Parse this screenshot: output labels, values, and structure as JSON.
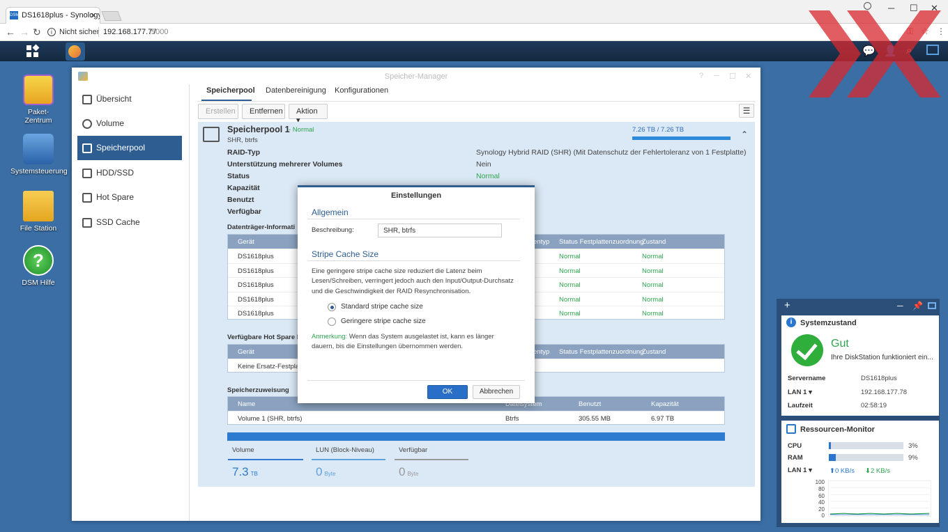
{
  "browser": {
    "tab_title": "DS1618plus - Synology D",
    "tab_close": "×",
    "fav_label": "DSM",
    "win_min": "─",
    "win_max": "☐",
    "win_close": "✕",
    "security_label": "Nicht sicher",
    "url_host": "192.168.177.77",
    "url_port": ":5000"
  },
  "desktop": {
    "icons": [
      {
        "label": "Paket-\nZentrum"
      },
      {
        "label": "Systemsteuerung"
      },
      {
        "label": "File Station"
      },
      {
        "label": "DSM Hilfe"
      }
    ]
  },
  "window": {
    "title": "Speicher-Manager",
    "controls": [
      "?",
      "─",
      "☐",
      "✕"
    ]
  },
  "sidebar": {
    "items": [
      {
        "label": "Übersicht"
      },
      {
        "label": "Volume"
      },
      {
        "label": "Speicherpool"
      },
      {
        "label": "HDD/SSD"
      },
      {
        "label": "Hot Spare"
      },
      {
        "label": "SSD Cache"
      }
    ]
  },
  "tabs": [
    {
      "label": "Speicherpool"
    },
    {
      "label": "Datenbereinigung"
    },
    {
      "label": "Konfigurationen"
    }
  ],
  "toolbar": {
    "create": "Erstellen",
    "remove": "Entfernen",
    "action": "Aktion ▾"
  },
  "pool": {
    "name": "Speicherpool 1",
    "status": "- Normal",
    "subtitle": "SHR, btrfs",
    "capacity_text": "7.26 TB / 7.26 TB",
    "capacity_fraction": 1.0,
    "props": [
      {
        "label": "RAID-Typ",
        "value": "Synology Hybrid RAID (SHR) (Mit Datenschutz der Fehlertoleranz von 1 Festplatte)"
      },
      {
        "label": "Unterstützung mehrerer Volumes",
        "value": "Nein"
      },
      {
        "label": "Status",
        "value": "Normal"
      },
      {
        "label": "Kapazität",
        "value": ""
      },
      {
        "label": "Benutzt",
        "value": ""
      },
      {
        "label": "Verfügbar",
        "value": ""
      }
    ],
    "disk_section": "Datenträger-Informati",
    "disk_headers": [
      "Gerät",
      "entyp",
      "Status Festplattenzuordnung",
      "Zustand"
    ],
    "disks": [
      {
        "device": "DS1618plus",
        "status": "Normal",
        "health": "Normal"
      },
      {
        "device": "DS1618plus",
        "status": "Normal",
        "health": "Normal"
      },
      {
        "device": "DS1618plus",
        "status": "Normal",
        "health": "Normal"
      },
      {
        "device": "DS1618plus",
        "status": "Normal",
        "health": "Normal"
      },
      {
        "device": "DS1618plus",
        "status": "Normal",
        "health": "Normal"
      }
    ],
    "hotspare_section": "Verfügbare Hot Spare F",
    "hotspare_headers": [
      "Gerät",
      "entyp",
      "Status Festplattenzuordnung",
      "Zustand"
    ],
    "hotspare_row": "Keine Ersatz-Festplatt",
    "alloc_section": "Speicherzuweisung",
    "alloc_headers": [
      "Name",
      "Dateisystem",
      "Benutzt",
      "Kapazität"
    ],
    "alloc_rows": [
      {
        "name": "Volume 1 (SHR, btrfs)",
        "fs": "Btrfs",
        "used": "305.55 MB",
        "cap": "6.97 TB"
      }
    ],
    "stats": [
      {
        "label": "Volume",
        "value": "7.3",
        "unit": "TB"
      },
      {
        "label": "LUN (Block-Niveau)",
        "value": "0",
        "unit": "Byte"
      },
      {
        "label": "Verfügbar",
        "value": "0",
        "unit": "Byte"
      }
    ]
  },
  "dialog": {
    "title": "Einstellungen",
    "general_heading": "Allgemein",
    "desc_label": "Beschreibung:",
    "desc_value": "SHR, btrfs",
    "stripe_heading": "Stripe Cache Size",
    "stripe_text": "Eine geringere stripe cache size reduziert die Latenz beim Lesen/Schreiben, verringert jedoch auch den Input/Output-Durchsatz und die Geschwindigkeit der RAID Resynchronisation.",
    "option_standard": "Standard stripe cache size",
    "option_lower": "Geringere stripe cache size",
    "note_key": "Anmerkung:",
    "note_text": " Wenn das System ausgelastet ist, kann es länger dauern, bis die Einstellungen übernommen werden.",
    "ok": "OK",
    "cancel": "Abbrechen"
  },
  "widget": {
    "health_title": "Systemzustand",
    "health_status": "Gut",
    "health_sub": "Ihre DiskStation funktioniert ein...",
    "rows": [
      {
        "label": "Servername",
        "value": "DS1618plus"
      },
      {
        "label": "LAN 1 ▾",
        "value": "192.168.177.78"
      },
      {
        "label": "Laufzeit",
        "value": "02:58:19"
      }
    ],
    "res_title": "Ressourcen-Monitor",
    "cpu_label": "CPU",
    "cpu_pct": "3%",
    "cpu_value": 3,
    "ram_label": "RAM",
    "ram_pct": "9%",
    "ram_value": 9,
    "lan_label": "LAN 1 ▾",
    "down": "0 KB/s",
    "up": "2 KB/s",
    "ticks": [
      "100",
      "80",
      "60",
      "40",
      "20",
      "0"
    ]
  }
}
